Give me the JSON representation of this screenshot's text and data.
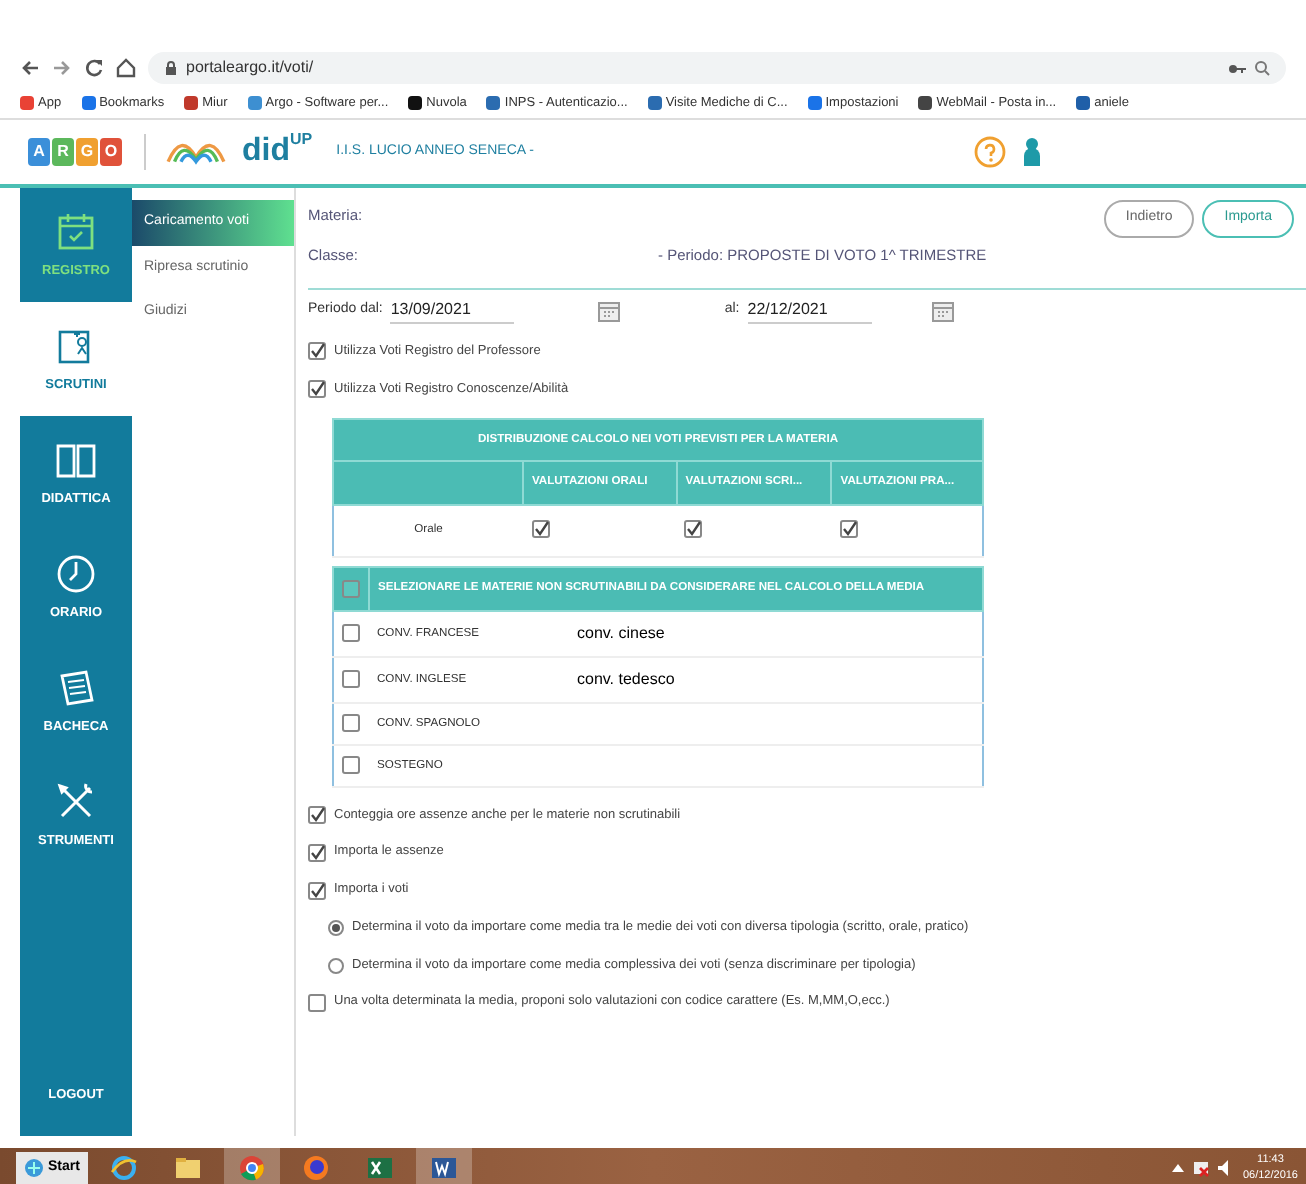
{
  "browser": {
    "url": "portaleargo.it/voti/",
    "bookmarks": [
      {
        "label": "App",
        "color": "#e94235"
      },
      {
        "label": "Bookmarks",
        "color": "#1a73e8"
      },
      {
        "label": "Miur",
        "color": "#c0392b"
      },
      {
        "label": "Argo - Software per...",
        "color": "#3d8fd1"
      },
      {
        "label": "Nuvola",
        "color": "#111111"
      },
      {
        "label": "INPS - Autenticazio...",
        "color": "#2b6cb0"
      },
      {
        "label": "Visite Mediche di C...",
        "color": "#2b6cb0"
      },
      {
        "label": "Impostazioni",
        "color": "#1a73e8"
      },
      {
        "label": "WebMail - Posta in...",
        "color": "#444444"
      },
      {
        "label": "aniele",
        "color": "#1f5fa8"
      }
    ]
  },
  "app_header": {
    "logo_letters": [
      {
        "letter": "A",
        "color": "#3b8fd9"
      },
      {
        "letter": "R",
        "color": "#5cb85c"
      },
      {
        "letter": "G",
        "color": "#f0a030"
      },
      {
        "letter": "O",
        "color": "#e0523a"
      }
    ],
    "product": "did",
    "product_sup": "UP",
    "school": "I.I.S. LUCIO ANNEO SENECA -"
  },
  "sidebar": {
    "items": [
      {
        "label": "REGISTRO",
        "selected": false,
        "highlight": true
      },
      {
        "label": "SCRUTINI",
        "selected": true,
        "highlight": false
      },
      {
        "label": "DIDATTICA",
        "selected": false,
        "highlight": false
      },
      {
        "label": "ORARIO",
        "selected": false,
        "highlight": false
      },
      {
        "label": "BACHECA",
        "selected": false,
        "highlight": false
      },
      {
        "label": "STRUMENTI",
        "selected": false,
        "highlight": false
      }
    ],
    "logout": "LOGOUT"
  },
  "submenu": [
    {
      "label": "Caricamento voti",
      "selected": true
    },
    {
      "label": "Ripresa scrutinio",
      "selected": false
    },
    {
      "label": "Giudizi",
      "selected": false
    }
  ],
  "header": {
    "materia": "Materia:",
    "classe": "Classe:",
    "periodo": "- Periodo: PROPOSTE DI VOTO 1^ TRIMESTRE",
    "buttons": [
      {
        "label": "Indietro",
        "kind": "secondary"
      },
      {
        "label": "Importa",
        "kind": "primary"
      }
    ]
  },
  "period": {
    "from_label": "Periodo dal:",
    "from": "13/09/2021",
    "to_label": "al:",
    "to": "22/12/2021"
  },
  "options_top": [
    {
      "label": "Utilizza Voti Registro del Professore",
      "checked": true
    },
    {
      "label": "Utilizza Voti Registro Conoscenze/Abilità",
      "checked": true
    }
  ],
  "distribution_table": {
    "title": "DISTRIBUZIONE CALCOLO NEI VOTI PREVISTI PER LA MATERIA",
    "columns": [
      "VALUTAZIONI ORALI",
      "VALUTAZIONI SCRI...",
      "VALUTAZIONI PRA..."
    ],
    "rows": [
      {
        "label": "Orale",
        "checks": [
          true,
          true,
          true
        ]
      }
    ]
  },
  "subjects_table": {
    "all_checked": false,
    "title": "SELEZIONARE LE MATERIE NON SCRUTINABILI DA CONSIDERARE NEL CALCOLO DELLA MEDIA",
    "rows": [
      {
        "label": "CONV. FRANCESE",
        "checked": false,
        "note": "conv. cinese"
      },
      {
        "label": "CONV. INGLESE",
        "checked": false,
        "note": "conv. tedesco"
      },
      {
        "label": "CONV. SPAGNOLO",
        "checked": false
      },
      {
        "label": "SOSTEGNO",
        "checked": false
      }
    ]
  },
  "options_bottom": [
    {
      "label": "Conteggia ore assenze anche per le materie non scrutinabili",
      "checked": true
    },
    {
      "label": "Importa le assenze",
      "checked": true
    },
    {
      "label": "Importa i voti",
      "checked": true
    }
  ],
  "vote_mode": [
    {
      "label": "Determina il voto da importare come media tra le medie dei voti con diversa tipologia (scritto, orale, pratico)",
      "selected": true
    },
    {
      "label": "Determina il voto da importare come media complessiva dei voti (senza discriminare per tipologia)",
      "selected": false
    }
  ],
  "option_last": {
    "label": "Una volta determinata la media, proponi solo valutazioni con codice carattere (Es. M,MM,O,ecc.)",
    "checked": false
  },
  "taskbar": {
    "start": "Start",
    "apps": [
      {
        "selected": false
      },
      {
        "selected": false
      },
      {
        "selected": true
      },
      {
        "selected": false
      },
      {
        "selected": false
      },
      {
        "selected": true
      }
    ],
    "time": "11:43",
    "date": "06/12/2016"
  }
}
